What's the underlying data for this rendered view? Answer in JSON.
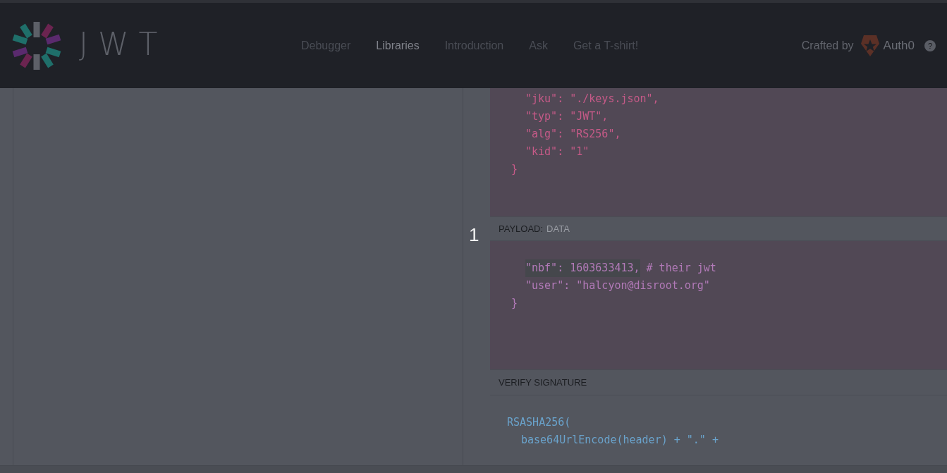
{
  "logo": {
    "text": "JWT"
  },
  "nav": [
    {
      "label": "Debugger",
      "selected": false
    },
    {
      "label": "Libraries",
      "selected": true
    },
    {
      "label": "Introduction",
      "selected": false
    },
    {
      "label": "Ask",
      "selected": false
    },
    {
      "label": "Get a T-shirt!",
      "selected": false
    }
  ],
  "credit": {
    "label": "Crafted by",
    "brand": "Auth0",
    "help": "?"
  },
  "gutter": {
    "step": "1"
  },
  "header_panel": {
    "lines": [
      {
        "kind": "member",
        "text": "\"jku\": \"./keys.json\","
      },
      {
        "kind": "member",
        "text": "\"typ\": \"JWT\","
      },
      {
        "kind": "member",
        "text": "\"alg\": \"RS256\","
      },
      {
        "kind": "member",
        "text": "\"kid\": \"1\""
      },
      {
        "kind": "brace",
        "text": "}"
      }
    ]
  },
  "payload_panel": {
    "title": "PAYLOAD:",
    "subtitle": "DATA",
    "lines": [
      {
        "kind": "member",
        "text": "\"nbf\": 1603633413,",
        "comment": "# their jwt",
        "highlighted": true
      },
      {
        "kind": "member",
        "text": "\"user\": \"halcyon@disroot.org\"",
        "highlighted": false
      },
      {
        "kind": "brace",
        "text": "}",
        "highlighted": false
      }
    ]
  },
  "signature_panel": {
    "title": "VERIFY SIGNATURE",
    "lines": [
      {
        "kind": "call",
        "text": "RSASHA256("
      },
      {
        "kind": "argument",
        "text": "base64UrlEncode(header) + \".\" +"
      }
    ]
  }
}
